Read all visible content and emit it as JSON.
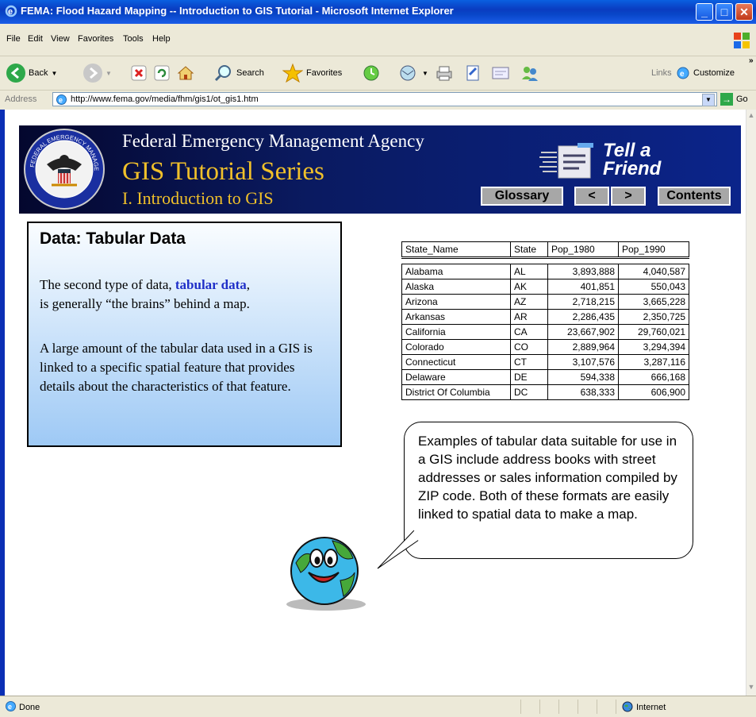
{
  "window": {
    "title": "FEMA: Flood Hazard Mapping -- Introduction to GIS Tutorial - Microsoft Internet Explorer"
  },
  "menu": [
    "File",
    "Edit",
    "View",
    "Favorites",
    "Tools",
    "Help"
  ],
  "toolbar": {
    "back": "Back",
    "search": "Search",
    "favorites": "Favorites",
    "links": "Links",
    "customize": "Customize"
  },
  "address": {
    "label": "Address",
    "url": "http://www.fema.gov/media/fhm/gis1/ot_gis1.htm",
    "go": "Go"
  },
  "banner": {
    "agency": "Federal Emergency Management Agency",
    "series": "GIS Tutorial Series",
    "section": "I. Introduction to GIS",
    "tell_a_friend": "Tell a",
    "tell_a_friend2": "Friend",
    "seal_text": "FEDERAL EMERGENCY MANAGEMENT AGENCY",
    "nav": {
      "glossary": "Glossary",
      "prev": "<",
      "next": ">",
      "contents": "Contents"
    }
  },
  "lesson": {
    "heading": "Data: Tabular Data",
    "p1_before": "The second type of data, ",
    "p1_highlight": "tabular data",
    "p1_after": ",",
    "p1_line2": "is generally “the brains” behind a map.",
    "p2": "A large amount of the tabular data used in a GIS is linked to a specific spatial feature that provides details about the characteristics of that feature."
  },
  "table": {
    "headers": [
      "State_Name",
      "State",
      "Pop_1980",
      "Pop_1990"
    ],
    "rows": [
      [
        "Alabama",
        "AL",
        "3,893,888",
        "4,040,587"
      ],
      [
        "Alaska",
        "AK",
        "401,851",
        "550,043"
      ],
      [
        "Arizona",
        "AZ",
        "2,718,215",
        "3,665,228"
      ],
      [
        "Arkansas",
        "AR",
        "2,286,435",
        "2,350,725"
      ],
      [
        "California",
        "CA",
        "23,667,902",
        "29,760,021"
      ],
      [
        "Colorado",
        "CO",
        "2,889,964",
        "3,294,394"
      ],
      [
        "Connecticut",
        "CT",
        "3,107,576",
        "3,287,116"
      ],
      [
        "Delaware",
        "DE",
        "594,338",
        "666,168"
      ],
      [
        "District Of Columbia",
        "DC",
        "638,333",
        "606,900"
      ]
    ]
  },
  "bubble": {
    "text": "Examples of tabular data suitable for use in a GIS include address books with street addresses or sales information compiled by ZIP code. Both of these formats are easily linked to spatial data to make a map."
  },
  "status": {
    "left": "Done",
    "zone": "Internet"
  }
}
